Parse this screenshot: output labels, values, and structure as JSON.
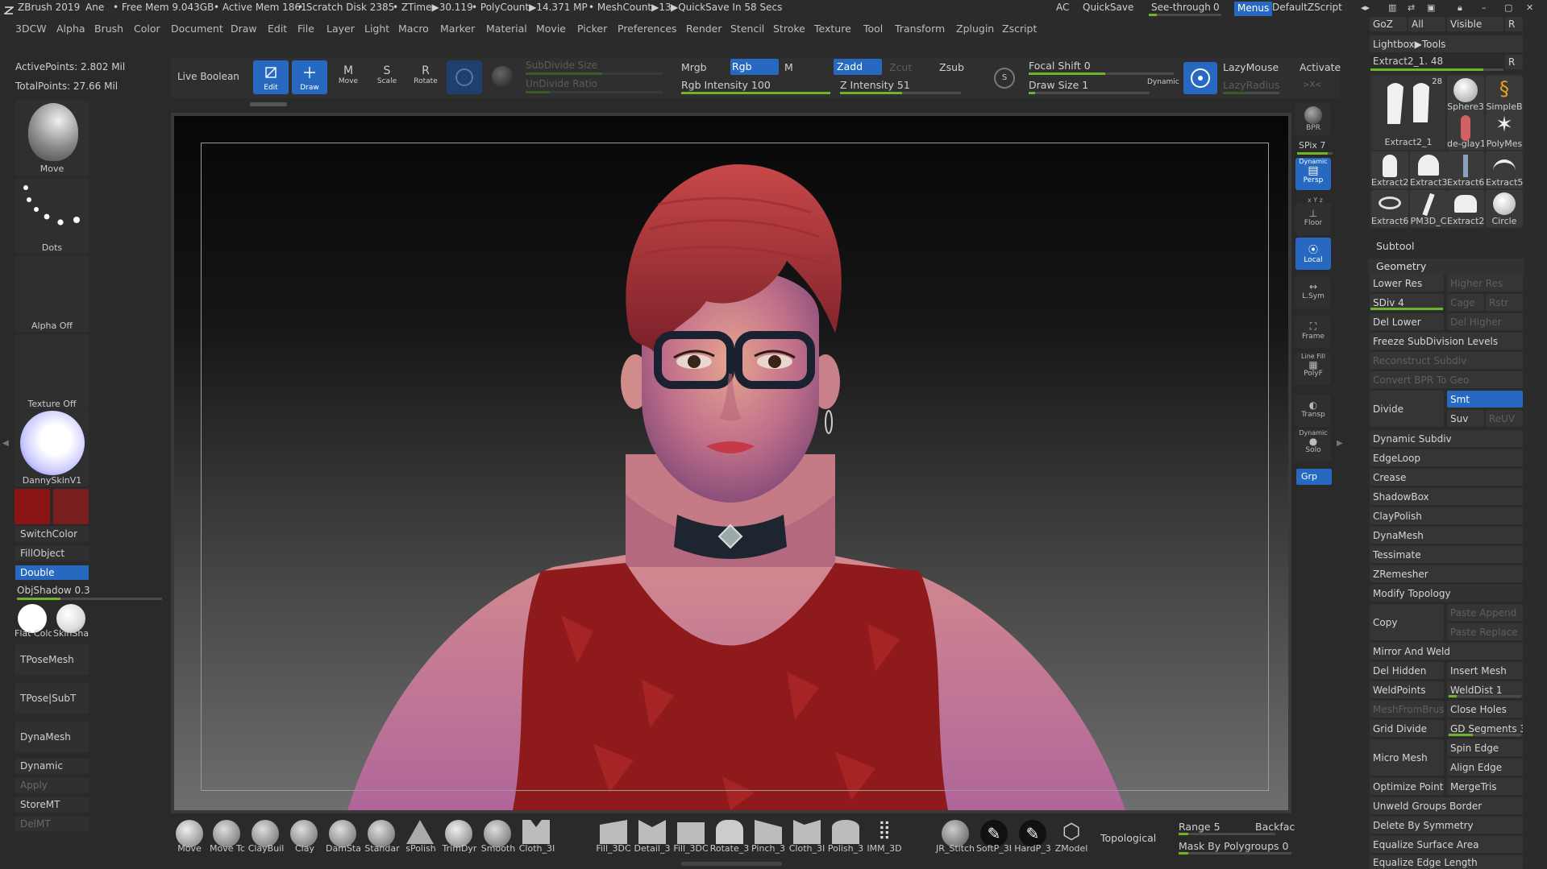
{
  "titlebar": {
    "app": "ZBrush 2019",
    "user": "Ane",
    "free_mem": "• Free Mem 9.043GB",
    "active_mem": "• Active Mem 1861",
    "scratch": "• Scratch Disk 2385",
    "ztime": "• ZTime▶30.119",
    "polycount": "• PolyCount▶14.371 MP",
    "meshcount": "• MeshCount▶13",
    "quicksave_in": "▶QuickSave In 58 Secs",
    "ac": "AC",
    "quicksave": "QuickSave",
    "seethrough": "See-through",
    "seethrough_val": "0",
    "menus": "Menus",
    "script": "DefaultZScript"
  },
  "menubar": [
    "3DCW",
    "Alpha",
    "Brush",
    "Color",
    "Document",
    "Draw",
    "Edit",
    "File",
    "Layer",
    "Light",
    "Macro",
    "Marker",
    "Material",
    "Movie",
    "Picker",
    "Preferences",
    "Render",
    "Stencil",
    "Stroke",
    "Texture",
    "Tool",
    "Transform",
    "Zplugin",
    "Zscript"
  ],
  "stats": {
    "active_points": "ActivePoints: 2.802 Mil",
    "total_points": "TotalPoints: 27.66 Mil"
  },
  "toolbar": {
    "live_boolean": "Live Boolean",
    "edit": "Edit",
    "draw": "Draw",
    "move": "Move",
    "scale": "Scale",
    "rotate": "Rotate",
    "subdivide_size": "SubDivide Size",
    "undivide_ratio": "UnDivide Ratio",
    "mrgb": "Mrgb",
    "rgb": "Rgb",
    "m": "M",
    "rgb_intensity": "Rgb Intensity 100",
    "zadd": "Zadd",
    "zcut": "Zcut",
    "zsub": "Zsub",
    "z_intensity": "Z Intensity 51",
    "focal_shift": "Focal Shift 0",
    "draw_size": "Draw Size 1",
    "dynamic": "Dynamic",
    "lazymouse": "LazyMouse",
    "lazyradius": "LazyRadius",
    "activate": "Activate",
    "xyz": ">X<"
  },
  "leftpanel": {
    "move": "Move",
    "dots": "Dots",
    "alpha_off": "Alpha Off",
    "texture_off": "Texture Off",
    "material": "DannySkinV1",
    "main_color": "#8b1414",
    "secondary_color": "#7a1d1d",
    "switchcolor": "SwitchColor",
    "fillobject": "FillObject",
    "double": "Double",
    "objshadow": "ObjShadow 0.3",
    "flat_color": "Flat Colc",
    "skin_shade": "SkinSha",
    "tposemesh": "TPoseMesh",
    "tpose_subt": "TPose|SubT",
    "dynamesh": "DynaMesh",
    "dynamic": "Dynamic",
    "apply": "Apply",
    "storemt": "StoreMT",
    "delmt": "DelMT"
  },
  "viewrail": {
    "bpr": "BPR",
    "spix": "SPix 7",
    "dynamic": "Dynamic",
    "persp": "Persp",
    "xyz": "x Y z",
    "floor": "Floor",
    "local": "Local",
    "lsym": "L.Sym",
    "frame": "Frame",
    "linefill": "Line Fill",
    "polyf": "PolyF",
    "transp": "Transp",
    "dynamic2": "Dynamic",
    "solo": "Solo",
    "grp": "Grp"
  },
  "rightpanel": {
    "goz": "GoZ",
    "all": "All",
    "visible": "Visible",
    "r": "R",
    "lightbox_tools": "Lightbox▶Tools",
    "current_tool": "Extract2_1. 48",
    "thumbs": [
      {
        "label": "Extract2_1",
        "badge": "28"
      },
      {
        "label": "Sphere3"
      },
      {
        "label": "SimpleB"
      },
      {
        "label": "de-glay1"
      },
      {
        "label": "PolyMes"
      },
      {
        "label": "Extract2"
      },
      {
        "label": "Extract3"
      },
      {
        "label": "Extract6"
      },
      {
        "label": "Extract5"
      },
      {
        "label": "Extract6"
      },
      {
        "label": "PM3D_C"
      },
      {
        "label": "Extract2"
      },
      {
        "label": "Circle"
      }
    ],
    "subtool": "Subtool",
    "geometry": "Geometry",
    "lower_res": "Lower Res",
    "higher_res": "Higher Res",
    "sdiv": "SDiv 4",
    "cage": "Cage",
    "rstr": "Rstr",
    "del_lower": "Del Lower",
    "del_higher": "Del Higher",
    "freeze": "Freeze SubDivision Levels",
    "reconstruct": "Reconstruct Subdiv",
    "convert_bpr": "Convert BPR To Geo",
    "divide": "Divide",
    "smt": "Smt",
    "suv": "Suv",
    "reuv": "ReUV",
    "dynamic_subdiv": "Dynamic Subdiv",
    "edgeloop": "EdgeLoop",
    "crease": "Crease",
    "shadowbox": "ShadowBox",
    "claypolish": "ClayPolish",
    "dynamesh": "DynaMesh",
    "tessimate": "Tessimate",
    "zremesher": "ZRemesher",
    "modify_topology": "Modify Topology",
    "copy": "Copy",
    "paste_append": "Paste Append",
    "paste_replace": "Paste Replace",
    "mirror_weld": "Mirror And Weld",
    "del_hidden": "Del Hidden",
    "insert_mesh": "Insert Mesh",
    "weldpoints": "WeldPoints",
    "welddist": "WeldDist 1",
    "meshfrombrush": "MeshFromBrush",
    "close_holes": "Close Holes",
    "grid_divide": "Grid Divide",
    "gd_segments": "GD Segments 3",
    "micro_mesh": "Micro Mesh",
    "spin_edge": "Spin Edge",
    "align_edge": "Align Edge",
    "optimize_points": "Optimize Points",
    "mergetris": "MergeTris",
    "unweld_groups": "Unweld Groups Border",
    "delete_symmetry": "Delete By Symmetry",
    "equalize_surface": "Equalize Surface Area",
    "equalize_edge": "Equalize Edge Length"
  },
  "bottombar": {
    "brushes": [
      "Move",
      "Move Tc",
      "ClayBuil",
      "Clay",
      "DamSta",
      "Standar",
      "sPolish",
      "TrimDyr",
      "Smooth",
      "Cloth_3I"
    ],
    "brushes2": [
      "Fill_3DC",
      "Detail_3",
      "Fill_3DC",
      "Rotate_3",
      "Pinch_3",
      "Cloth_3I",
      "Polish_3",
      "IMM_3D"
    ],
    "brushes3": [
      "JR_Stitch",
      "SoftP_3I",
      "HardP_3",
      "ZModel"
    ],
    "topological": "Topological",
    "range": "Range 5",
    "backface": "Backfac",
    "mask_poly": "Mask By Polygroups 0"
  }
}
